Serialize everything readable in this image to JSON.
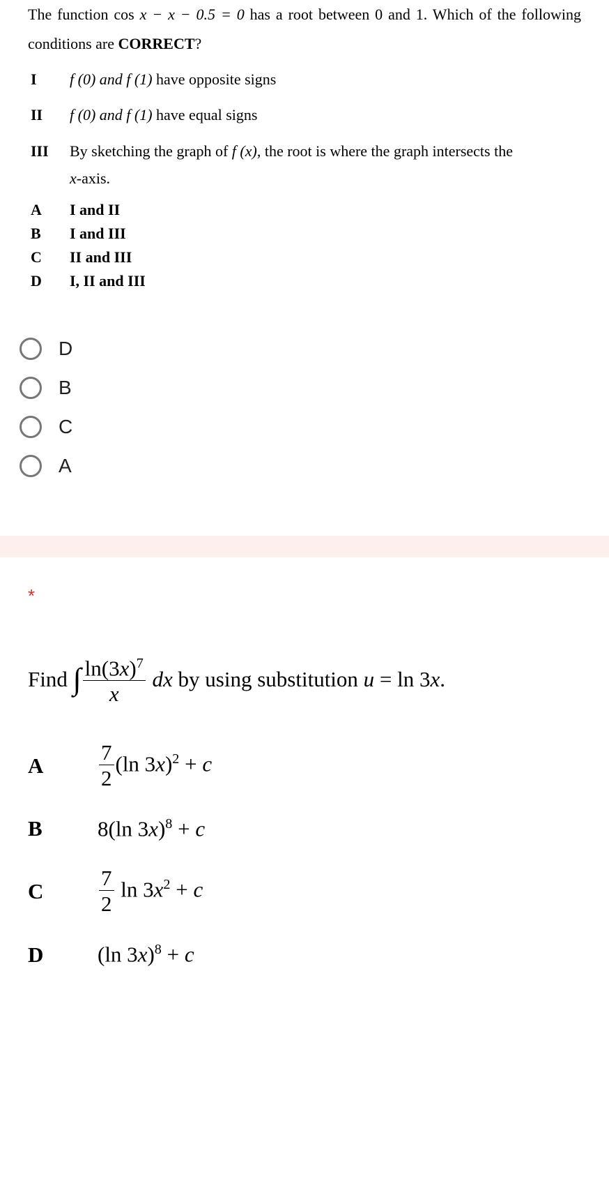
{
  "q1": {
    "text_part1": "The function  cos",
    "text_eq": " x − x − 0.5 = 0",
    "text_part2": "  has a root between 0 and 1. Which of the following conditions are ",
    "text_bold": "CORRECT",
    "text_q": "?",
    "statements": {
      "I": {
        "label": "I",
        "pre": "f (0) and  f (1)",
        "post": " have opposite signs"
      },
      "II": {
        "label": "II",
        "pre": "f (0) and  f (1)",
        "post": " have equal signs"
      },
      "III": {
        "label": "III",
        "pre": "By sketching the graph of  ",
        "mid": "f (x)",
        "post": ",  the root is where the graph intersects the ",
        "post2": "x",
        "post3": "-axis."
      }
    },
    "options": {
      "A": {
        "label": "A",
        "text": "I and II"
      },
      "B": {
        "label": "B",
        "text": "I and III"
      },
      "C": {
        "label": "C",
        "text": "II and III"
      },
      "D": {
        "label": "D",
        "text": "I, II and III"
      }
    },
    "radios": {
      "r1": "D",
      "r2": "B",
      "r3": "C",
      "r4": "A"
    }
  },
  "asterisk": "*",
  "q2": {
    "find": "Find ",
    "frac_num_1": "ln(3",
    "frac_num_x": "x",
    "frac_num_2": ")",
    "frac_num_sup": "7",
    "frac_den": "x",
    "dx": " dx",
    "mid": "  by using substitution  ",
    "sub_u": "u",
    "sub_eq": " = ln 3",
    "sub_x": "x",
    "sub_dot": ".",
    "options": {
      "A": {
        "label": "A",
        "frac_num": "7",
        "frac_den": "2",
        "body1": "(ln 3",
        "body_x": "x",
        "body2": ")",
        "sup": "2",
        "tail": " + ",
        "c": "c"
      },
      "B": {
        "label": "B",
        "pre": "8(ln 3",
        "x": "x",
        "post": ")",
        "sup": "8",
        "tail": " + ",
        "c": "c"
      },
      "C": {
        "label": "C",
        "frac_num": "7",
        "frac_den": "2",
        "body1": " ln 3",
        "body_x": "x",
        "sup": "2",
        "tail": " + ",
        "c": "c"
      },
      "D": {
        "label": "D",
        "pre": "(ln 3",
        "x": "x",
        "post": ")",
        "sup": "8",
        "tail": " + ",
        "c": "c"
      }
    }
  }
}
